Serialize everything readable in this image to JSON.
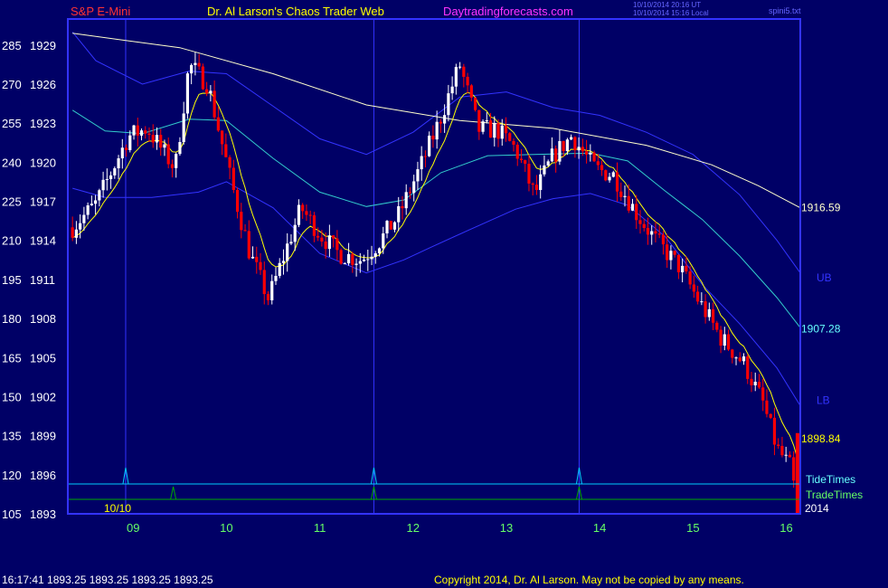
{
  "header": {
    "symbol": "S&P E-Mini",
    "author": "Dr. Al Larson's Chaos Trader Web",
    "site": "Daytradingforecasts.com",
    "utc_stamp": "10/10/2014 20:16 UT",
    "local_stamp": "10/10/2014 15:16 Local",
    "file_name": "spini5.txt"
  },
  "footer": {
    "quote": "16:17:41  1893.25 1893.25 1893.25 1893.25",
    "copyright": "Copyright 2014, Dr. Al Larson. May not be copied by any means."
  },
  "colors": {
    "background": "#000066",
    "frame": "#3333ff",
    "up_candle": "#ffffff",
    "down_candle": "#ff0000",
    "ma_yellow": "#ffff00",
    "ma_white": "#ffffcc",
    "ma_cyan": "#33cccc",
    "band_blue": "#3333ff",
    "tide": "#00ccff",
    "trade": "#00aa00",
    "label_yellow": "#ffff00",
    "label_cyan": "#66ffff",
    "label_green": "#66ff66",
    "label_red": "#ff3333",
    "label_magenta": "#ff33ff"
  },
  "chart_data": {
    "type": "candlestick",
    "title": "S&P E-Mini",
    "ylim": [
      1893,
      1931
    ],
    "y_ticks": [
      {
        "code": "105",
        "price": "1893"
      },
      {
        "code": "120",
        "price": "1896"
      },
      {
        "code": "135",
        "price": "1899"
      },
      {
        "code": "150",
        "price": "1902"
      },
      {
        "code": "165",
        "price": "1905"
      },
      {
        "code": "180",
        "price": "1908"
      },
      {
        "code": "195",
        "price": "1911"
      },
      {
        "code": "210",
        "price": "1914"
      },
      {
        "code": "225",
        "price": "1917"
      },
      {
        "code": "240",
        "price": "1920"
      },
      {
        "code": "255",
        "price": "1923"
      },
      {
        "code": "270",
        "price": "1926"
      },
      {
        "code": "285",
        "price": "1929"
      }
    ],
    "x_range": [
      8.3,
      16.15
    ],
    "x_ticks": [
      "09",
      "10",
      "11",
      "12",
      "13",
      "14",
      "15",
      "16"
    ],
    "date_label": "10/10",
    "year_label": "2014",
    "ohlc_anchors": [
      [
        8.35,
        1915.0
      ],
      [
        8.6,
        1916.8
      ],
      [
        8.95,
        1922.0
      ],
      [
        9.15,
        1922.6
      ],
      [
        9.45,
        1919.5
      ],
      [
        9.6,
        1927.5
      ],
      [
        9.8,
        1926.0
      ],
      [
        10.05,
        1918.5
      ],
      [
        10.25,
        1913.0
      ],
      [
        10.45,
        1909.5
      ],
      [
        10.6,
        1912.5
      ],
      [
        10.8,
        1916.5
      ],
      [
        11.0,
        1914.5
      ],
      [
        11.2,
        1913.0
      ],
      [
        11.45,
        1912.5
      ],
      [
        11.65,
        1914.0
      ],
      [
        11.85,
        1916.0
      ],
      [
        12.1,
        1920.0
      ],
      [
        12.3,
        1923.5
      ],
      [
        12.5,
        1927.5
      ],
      [
        12.7,
        1922.5
      ],
      [
        12.9,
        1922.5
      ],
      [
        13.1,
        1921.0
      ],
      [
        13.3,
        1917.5
      ],
      [
        13.5,
        1920.5
      ],
      [
        13.7,
        1922.0
      ],
      [
        13.95,
        1919.5
      ],
      [
        14.15,
        1919.0
      ],
      [
        14.4,
        1916.0
      ],
      [
        14.6,
        1914.0
      ],
      [
        14.85,
        1912.0
      ],
      [
        15.05,
        1909.5
      ],
      [
        15.3,
        1906.5
      ],
      [
        15.55,
        1904.5
      ],
      [
        15.75,
        1901.5
      ],
      [
        15.9,
        1898.0
      ],
      [
        16.05,
        1896.5
      ],
      [
        16.12,
        1893.3
      ]
    ],
    "lines": {
      "ma_white": [
        [
          8.35,
          1929.9
        ],
        [
          9.5,
          1928.8
        ],
        [
          10.5,
          1926.8
        ],
        [
          11.5,
          1924.4
        ],
        [
          12.5,
          1923.2
        ],
        [
          13.5,
          1922.6
        ],
        [
          14.5,
          1921.3
        ],
        [
          15.2,
          1919.8
        ],
        [
          15.7,
          1918.2
        ],
        [
          16.15,
          1916.5
        ]
      ],
      "ma_cyan": [
        [
          8.35,
          1924.0
        ],
        [
          8.7,
          1922.4
        ],
        [
          9.1,
          1922.2
        ],
        [
          9.6,
          1923.3
        ],
        [
          10.0,
          1923.2
        ],
        [
          10.5,
          1920.3
        ],
        [
          11.0,
          1917.7
        ],
        [
          11.5,
          1916.6
        ],
        [
          11.9,
          1917.1
        ],
        [
          12.3,
          1919.2
        ],
        [
          12.8,
          1920.5
        ],
        [
          13.3,
          1920.6
        ],
        [
          13.9,
          1920.7
        ],
        [
          14.3,
          1920.1
        ],
        [
          14.7,
          1917.8
        ],
        [
          15.1,
          1915.6
        ],
        [
          15.5,
          1912.8
        ],
        [
          15.9,
          1909.6
        ],
        [
          16.15,
          1907.3
        ]
      ],
      "band_upper": [
        [
          8.35,
          1930.0
        ],
        [
          8.6,
          1927.8
        ],
        [
          9.1,
          1926.0
        ],
        [
          9.6,
          1927.0
        ],
        [
          10.0,
          1926.8
        ],
        [
          10.5,
          1924.3
        ],
        [
          11.0,
          1921.8
        ],
        [
          11.5,
          1920.6
        ],
        [
          12.0,
          1922.3
        ],
        [
          12.5,
          1925.0
        ],
        [
          13.0,
          1925.4
        ],
        [
          13.5,
          1924.2
        ],
        [
          14.0,
          1923.6
        ],
        [
          14.5,
          1922.3
        ],
        [
          15.0,
          1920.6
        ],
        [
          15.5,
          1917.5
        ],
        [
          15.9,
          1914.0
        ],
        [
          16.15,
          1911.5
        ]
      ],
      "band_lower": [
        [
          8.35,
          1918.0
        ],
        [
          8.7,
          1917.3
        ],
        [
          9.2,
          1917.3
        ],
        [
          9.7,
          1917.7
        ],
        [
          10.0,
          1918.5
        ],
        [
          10.5,
          1916.5
        ],
        [
          11.0,
          1913.0
        ],
        [
          11.5,
          1911.5
        ],
        [
          11.9,
          1912.5
        ],
        [
          12.2,
          1913.5
        ],
        [
          12.6,
          1914.8
        ],
        [
          13.1,
          1916.4
        ],
        [
          13.5,
          1917.2
        ],
        [
          13.9,
          1917.6
        ],
        [
          14.3,
          1916.7
        ],
        [
          14.7,
          1914.3
        ],
        [
          15.1,
          1910.6
        ],
        [
          15.5,
          1907.6
        ],
        [
          15.9,
          1904.2
        ],
        [
          16.15,
          1901.3
        ]
      ]
    },
    "cycle_lines": [
      8.92,
      11.58,
      13.78
    ],
    "tide_times": [
      8.92,
      11.58,
      13.78
    ],
    "trade_times": [
      9.43,
      11.58,
      13.78
    ],
    "right_labels": [
      {
        "text": "1916.59",
        "role": "ma_white",
        "value": 1916.59
      },
      {
        "text": "UB",
        "role": "upper_band",
        "value": 1911.2
      },
      {
        "text": "1907.28",
        "role": "ma_cyan",
        "value": 1907.28
      },
      {
        "text": "LB",
        "role": "lower_band",
        "value": 1901.8
      },
      {
        "text": "1898.84",
        "role": "ma_yellow",
        "value": 1898.84
      }
    ],
    "legend": [
      "TideTimes",
      "TradeTimes"
    ]
  }
}
